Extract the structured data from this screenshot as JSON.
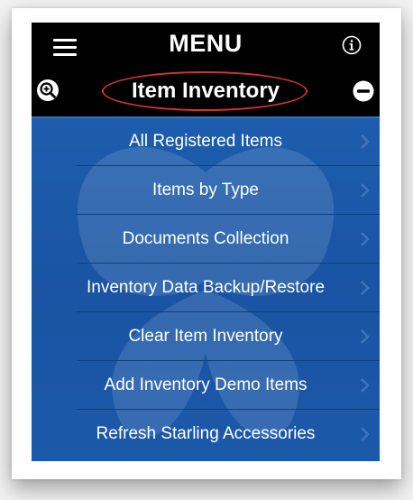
{
  "header": {
    "title": "MENU"
  },
  "section": {
    "title": "Item Inventory"
  },
  "menu": {
    "items": [
      {
        "label": "All Registered Items"
      },
      {
        "label": "Items by Type"
      },
      {
        "label": "Documents Collection"
      },
      {
        "label": "Inventory Data Backup/Restore"
      },
      {
        "label": "Clear Item Inventory"
      },
      {
        "label": "Add Inventory Demo Items"
      },
      {
        "label": "Refresh Starling Accessories"
      }
    ]
  },
  "icons": {
    "menu": "hamburger-icon",
    "info": "info-icon",
    "zoom": "zoom-in-icon",
    "collapse": "minus-circle-icon",
    "chevron": "chevron-right-icon"
  },
  "colors": {
    "bar": "#000000",
    "list_background": "#1b58a8",
    "highlight_ellipse": "#d0342c",
    "text": "#ffffff"
  }
}
